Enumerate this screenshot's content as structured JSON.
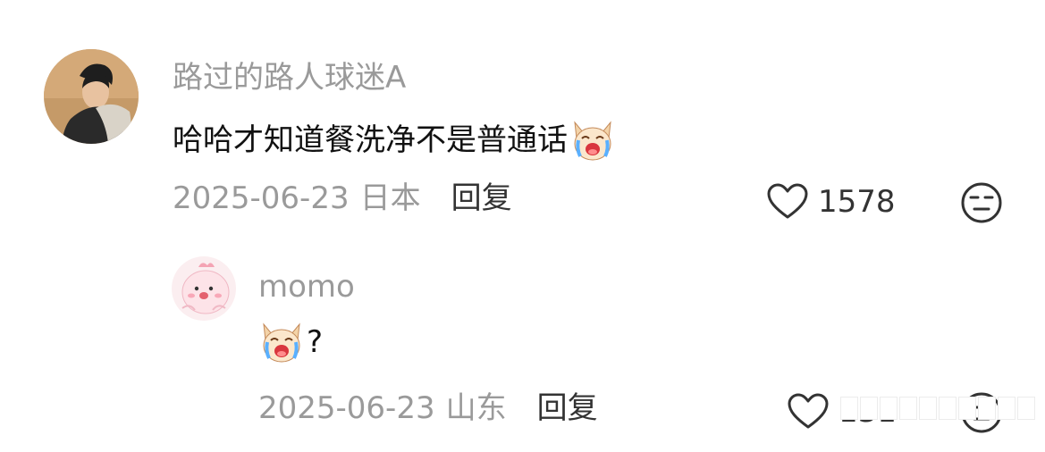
{
  "comment": {
    "username": "路过的路人球迷A",
    "content_text": "哈哈才知道餐洗净不是普通话",
    "emoji": "crying-dog-emoji",
    "date": "2025-06-23",
    "location": "日本",
    "reply_label": "回复",
    "like_count": "1578",
    "dislike_icon": "neutral-face-icon"
  },
  "reply": {
    "username": "momo",
    "emoji": "crying-dog-emoji",
    "content_text": "?",
    "date": "2025-06-23",
    "location": "山东",
    "reply_label": "回复",
    "like_count": "131",
    "dislike_icon": "neutral-face-icon"
  },
  "colors": {
    "username": "#9a9a9a",
    "text": "#111111",
    "meta": "#9a9a9a",
    "action": "#333333"
  }
}
